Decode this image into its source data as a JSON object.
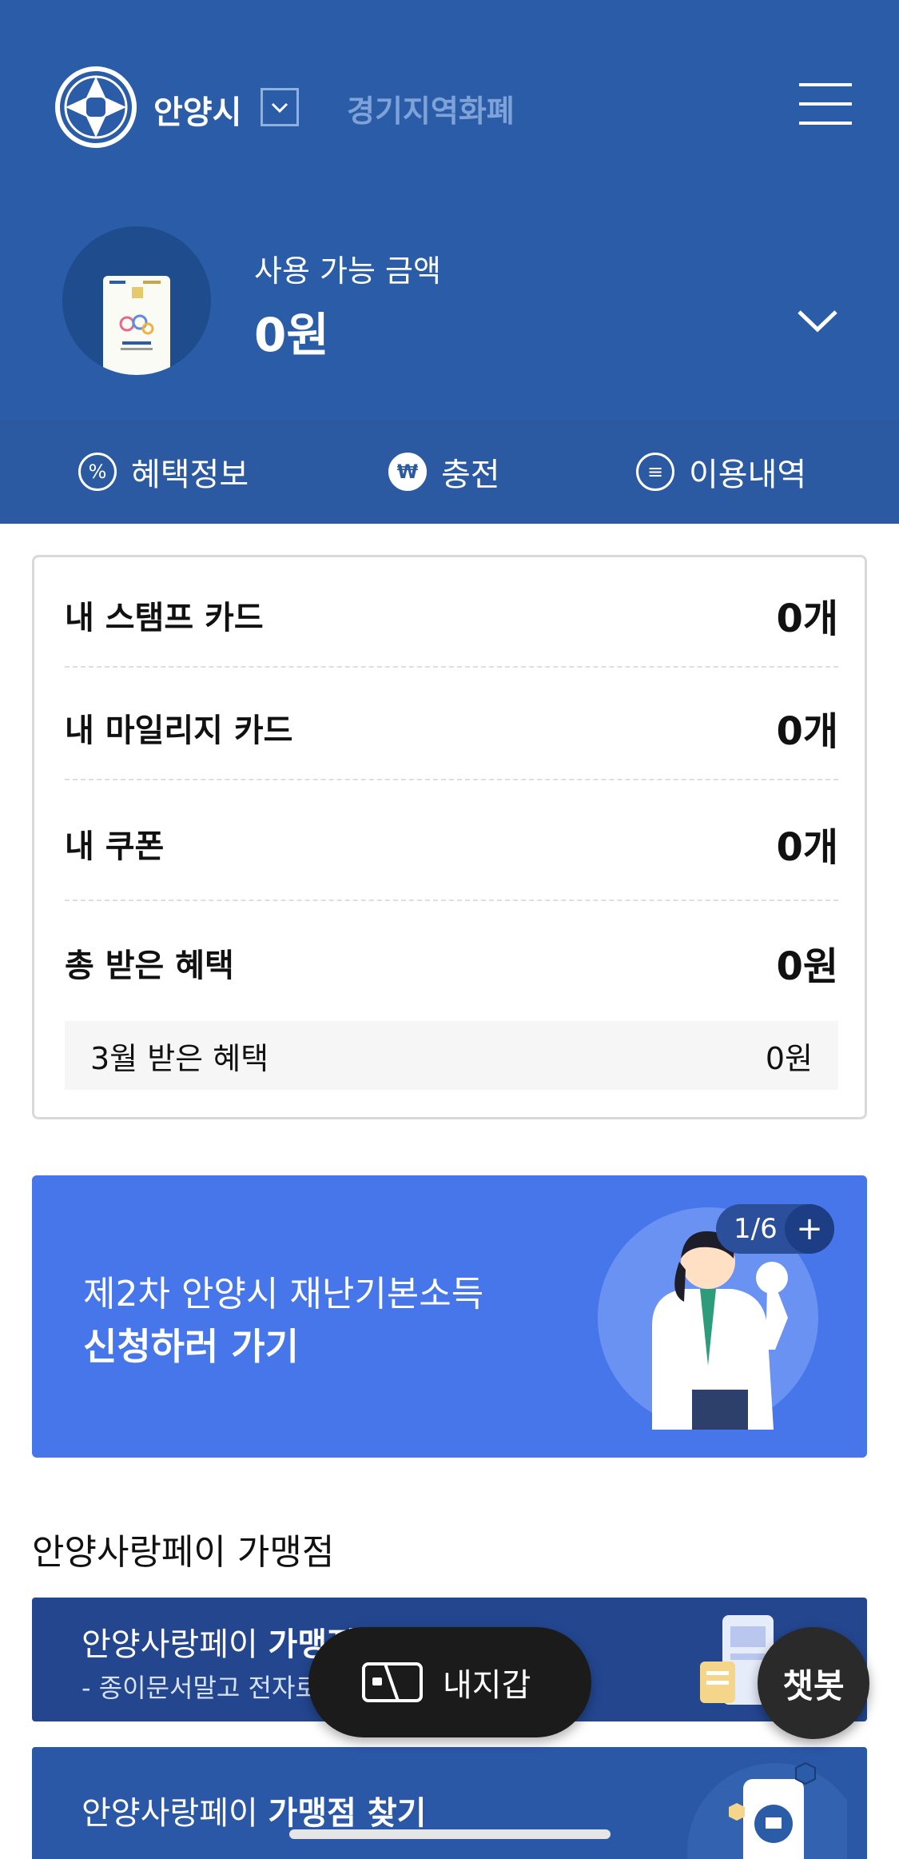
{
  "header": {
    "city": "안양시",
    "region": "경기지역화폐"
  },
  "balance": {
    "label": "사용 가능 금액",
    "amount": "0원"
  },
  "quick_menu": [
    {
      "label": "혜택정보",
      "icon": "percent-icon",
      "glyph": "%"
    },
    {
      "label": "충전",
      "icon": "won-icon",
      "glyph": "₩"
    },
    {
      "label": "이용내역",
      "icon": "list-icon",
      "glyph": "≡"
    }
  ],
  "stats": {
    "rows": [
      {
        "label": "내 스탬프 카드",
        "value": "0개"
      },
      {
        "label": "내 마일리지 카드",
        "value": "0개"
      },
      {
        "label": "내 쿠폰",
        "value": "0개"
      },
      {
        "label": "총 받은 혜택",
        "value": "0원"
      }
    ],
    "month_benefit": {
      "label": "3월 받은 혜택",
      "value": "0원"
    }
  },
  "banner": {
    "line1": "제2차 안양시 재난기본소득",
    "line2": "신청하러 가기",
    "pager": "1/6",
    "plus": "+"
  },
  "merchants": {
    "title": "안양사랑페이 가맹점",
    "promo1": {
      "prefix": "안양사랑페이 ",
      "bold": "가맹점 신청하기",
      "sub": "- 종이문서말고 전자로 간편하게 신청하세요! -"
    },
    "promo2": {
      "prefix": "안양사랑페이 ",
      "bold": "가맹점 찾기"
    }
  },
  "floating": {
    "wallet": "내지갑",
    "chatbot": "챗봇"
  },
  "colors": {
    "header_bg": "#2b5ca8",
    "banner_bg": "#4776ea",
    "promo_bg": "#23468f"
  }
}
